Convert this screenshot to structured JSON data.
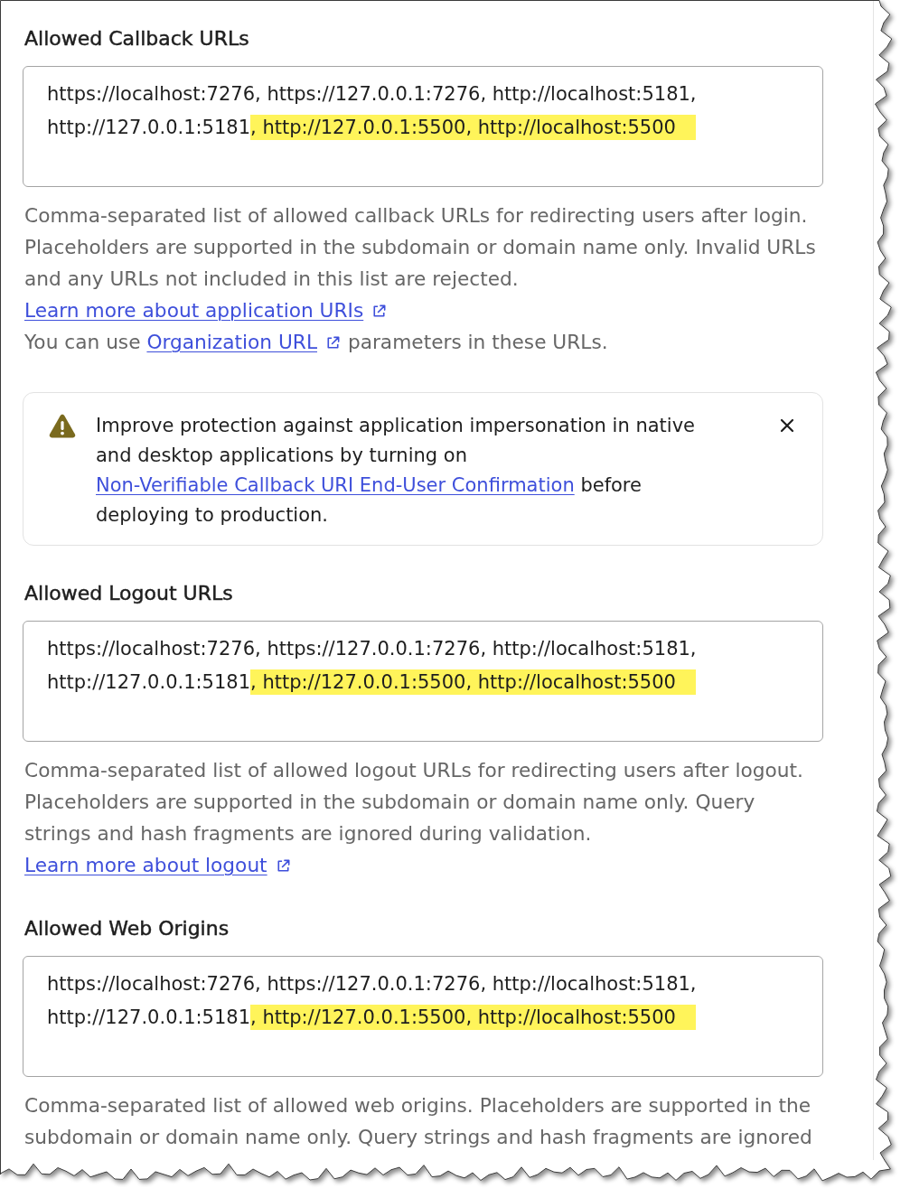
{
  "blocks": [
    {
      "kind": "url_setting",
      "title": "Allowed Callback URLs",
      "field": {
        "value": [
          {
            "text": "https://localhost:7276, https://127.0.0.1:7276, http://localhost:5181, http://127.0.0.1:5181",
            "highlighted": false
          },
          {
            "text": ", http://127.0.0.1:5500, http://localhost:5500",
            "highlighted": true
          }
        ]
      },
      "help": [
        {
          "kind": "text",
          "text": "Comma-separated list of allowed callback URLs for redirecting users after login. Placeholders are supported in the subdomain or domain name only. Invalid URLs and any URLs not included in this list are rejected."
        },
        {
          "kind": "link",
          "text": "Learn more about application URIs"
        },
        {
          "kind": "text_with_link",
          "before": "You can use ",
          "link": "Organization URL",
          "after": " parameters in these URLs."
        }
      ]
    },
    {
      "kind": "alert",
      "before": "Improve protection against application impersonation in native and desktop applications by turning on ",
      "link": "Non-Verifiable Callback URI End-User Confirmation",
      "after": " before deploying to production.",
      "dismissible": true
    },
    {
      "kind": "url_setting",
      "title": "Allowed Logout URLs",
      "field": {
        "value": [
          {
            "text": "https://localhost:7276, https://127.0.0.1:7276, http://localhost:5181, http://127.0.0.1:5181",
            "highlighted": false
          },
          {
            "text": ", http://127.0.0.1:5500, http://localhost:5500",
            "highlighted": true
          }
        ]
      },
      "help": [
        {
          "kind": "text",
          "text": "Comma-separated list of allowed logout URLs for redirecting users after logout. Placeholders are supported in the subdomain or domain name only. Query strings and hash fragments are ignored during validation."
        },
        {
          "kind": "link",
          "text": "Learn more about logout"
        }
      ]
    },
    {
      "kind": "url_setting",
      "title": "Allowed Web Origins",
      "field": {
        "value": [
          {
            "text": "https://localhost:7276, https://127.0.0.1:7276, http://localhost:5181, http://127.0.0.1:5181",
            "highlighted": false
          },
          {
            "text": ", http://127.0.0.1:5500, http://localhost:5500",
            "highlighted": true
          }
        ]
      },
      "help": [
        {
          "kind": "text",
          "text": "Comma-separated list of allowed web origins. Placeholders are supported in the subdomain or domain name only. Query strings and hash fragments are ignored"
        }
      ]
    }
  ]
}
